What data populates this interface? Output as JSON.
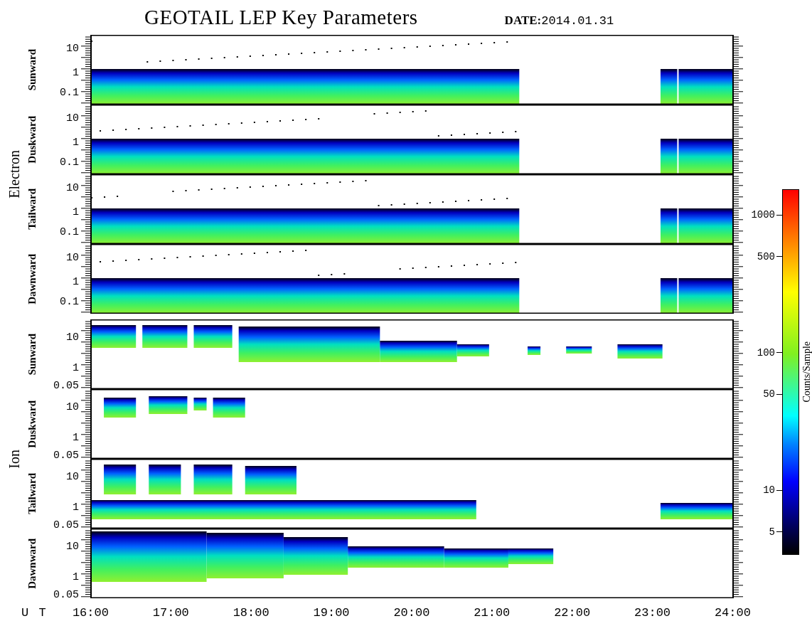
{
  "title": "GEOTAIL LEP Key Parameters",
  "date": "**DATE:**2014.01.31",
  "groups": [
    {
      "name": "Electron",
      "kind": "electron",
      "panels": [
        {
          "label": "Sunward",
          "ticks": [
            "10",
            "1",
            "0.1"
          ]
        },
        {
          "label": "Duskward",
          "ticks": [
            "10",
            "1",
            "0.1"
          ]
        },
        {
          "label": "Tailward",
          "ticks": [
            "10",
            "1",
            "0.1"
          ]
        },
        {
          "label": "Dawnward",
          "ticks": [
            "10",
            "1",
            "0.1"
          ]
        }
      ]
    },
    {
      "name": "Ion",
      "kind": "ion",
      "panels": [
        {
          "label": "Sunward",
          "ticks": [
            "10",
            "1",
            "0.05"
          ]
        },
        {
          "label": "Duskward",
          "ticks": [
            "10",
            "1",
            "0.05"
          ]
        },
        {
          "label": "Tailward",
          "ticks": [
            "10",
            "1",
            "0.05"
          ]
        },
        {
          "label": "Dawnward",
          "ticks": [
            "10",
            "1",
            "0.05"
          ]
        }
      ]
    }
  ],
  "time_axis": {
    "label": "U T",
    "ticks": [
      "16:00",
      "17:00",
      "18:00",
      "19:00",
      "20:00",
      "21:00",
      "22:00",
      "23:00",
      "24:00"
    ]
  },
  "colorbar": {
    "title": "Counts/Sample",
    "ticks": [
      "1000",
      "500",
      "100",
      "50",
      "10",
      "5"
    ]
  }
}
